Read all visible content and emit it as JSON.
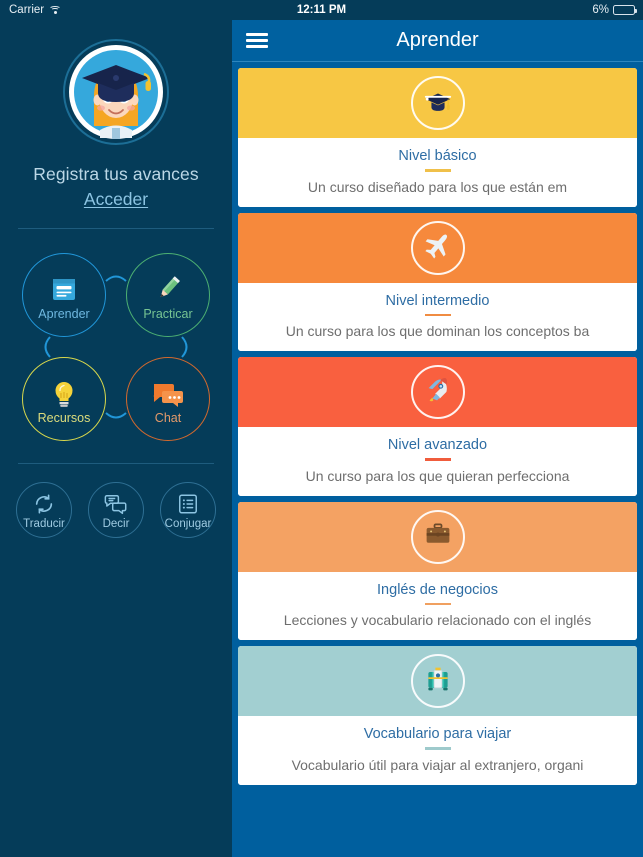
{
  "status_bar": {
    "carrier": "Carrier",
    "wifi_icon": "wifi-icon",
    "time": "12:11 PM",
    "battery_percent": "6%",
    "battery_level": 6,
    "battery_color": "#E8453C"
  },
  "sidebar": {
    "avatar_icon": "graduate-girl-avatar",
    "register_text": "Registra tus avances",
    "login_link": "Acceder",
    "nav_items": [
      {
        "label": "Aprender",
        "icon": "book-icon",
        "color": "#2196D8"
      },
      {
        "label": "Practicar",
        "icon": "pencil-icon",
        "color": "#4CAF72"
      },
      {
        "label": "Recursos",
        "icon": "lightbulb-icon",
        "color": "#D8D84C"
      },
      {
        "label": "Chat",
        "icon": "chat-bubbles-icon",
        "color": "#D2692E"
      }
    ],
    "tools": [
      {
        "label": "Traducir",
        "icon": "refresh-cycle-icon"
      },
      {
        "label": "Decir",
        "icon": "speech-bubbles-icon"
      },
      {
        "label": "Conjugar",
        "icon": "list-icon"
      }
    ]
  },
  "header": {
    "menu_icon": "hamburger-menu-icon",
    "title": "Aprender"
  },
  "courses": [
    {
      "title": "Nivel básico",
      "description": "Un curso diseñado para los que están em",
      "banner_color": "#F7C744",
      "rule_color": "#F0C04A",
      "icon": "graduation-cap-icon"
    },
    {
      "title": "Nivel intermedio",
      "description": "Un curso para los que dominan los conceptos ba",
      "banner_color": "#F6893C",
      "rule_color": "#F08C42",
      "icon": "airplane-icon"
    },
    {
      "title": "Nivel avanzado",
      "description": "Un curso para los que quieran perfecciona",
      "banner_color": "#F9603F",
      "rule_color": "#F05C3C",
      "icon": "rocket-icon"
    },
    {
      "title": "Inglés de negocios",
      "description": "Lecciones y vocabulario relacionado con el inglés",
      "banner_color": "#F4A263",
      "rule_color": "#F0A060",
      "icon": "briefcase-icon"
    },
    {
      "title": "Vocabulario para viajar",
      "description": "Vocabulario útil para viajar al extranjero, organi",
      "banner_color": "#A2CFD1",
      "rule_color": "#9ECACC",
      "icon": "suitcase-icon"
    }
  ]
}
